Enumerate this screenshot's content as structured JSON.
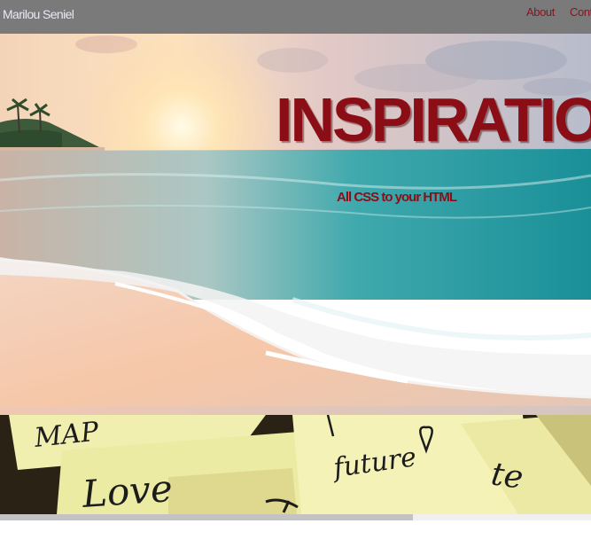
{
  "navbar": {
    "brand": "Marilou Seniel",
    "links": [
      {
        "label": "About"
      },
      {
        "label": "Conta"
      }
    ]
  },
  "hero": {
    "title": "INSPIRATION",
    "subtitle": "All CSS to your HTML"
  },
  "notes": {
    "words": [
      "MAP",
      "Love",
      "future",
      "te"
    ]
  },
  "colors": {
    "navbar_bg": "#7a7a7a",
    "brand_text": "#e8eaf6",
    "accent": "#8b0e17"
  }
}
